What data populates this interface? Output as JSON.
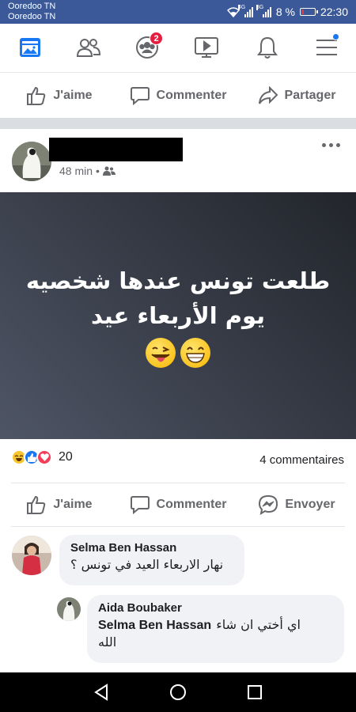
{
  "status_bar": {
    "carrier_1": "Ooredoo TN",
    "carrier_2": "Ooredoo TN",
    "signal_1_tag": "4G",
    "signal_2_tag": "3G",
    "battery": "8 %",
    "time": "22:30"
  },
  "nav": {
    "groups_badge": "2",
    "icons": [
      "feed-icon",
      "friends-icon",
      "groups-icon",
      "watch-icon",
      "notifications-icon",
      "menu-icon"
    ]
  },
  "top_actions": {
    "like": "J'aime",
    "comment": "Commenter",
    "share": "Partager"
  },
  "post": {
    "time": "48 min",
    "separator": "•",
    "text_line_1": "طلعت تونس عندها شخصيه",
    "text_line_2": "يوم الأربعاء عيد",
    "reaction_count": "20",
    "comments_count": "4 commentaires",
    "background_colors": [
      "#4e5565",
      "#22252b"
    ]
  },
  "post_actions": {
    "like": "J'aime",
    "comment": "Commenter",
    "send": "Envoyer"
  },
  "comments": [
    {
      "author": "Selma Ben Hassan",
      "text": "نهار الاربعاء العيد في تونس ؟"
    },
    {
      "author": "Aida Boubaker",
      "mention": "Selma Ben Hassan",
      "text_after_mention": "اي أختي ان شاء",
      "text_line_2": "الله"
    }
  ],
  "colors": {
    "brand": "#3b5998",
    "accent": "#1877f2",
    "badge": "#e41e3f",
    "icon_gray": "#65676b"
  }
}
